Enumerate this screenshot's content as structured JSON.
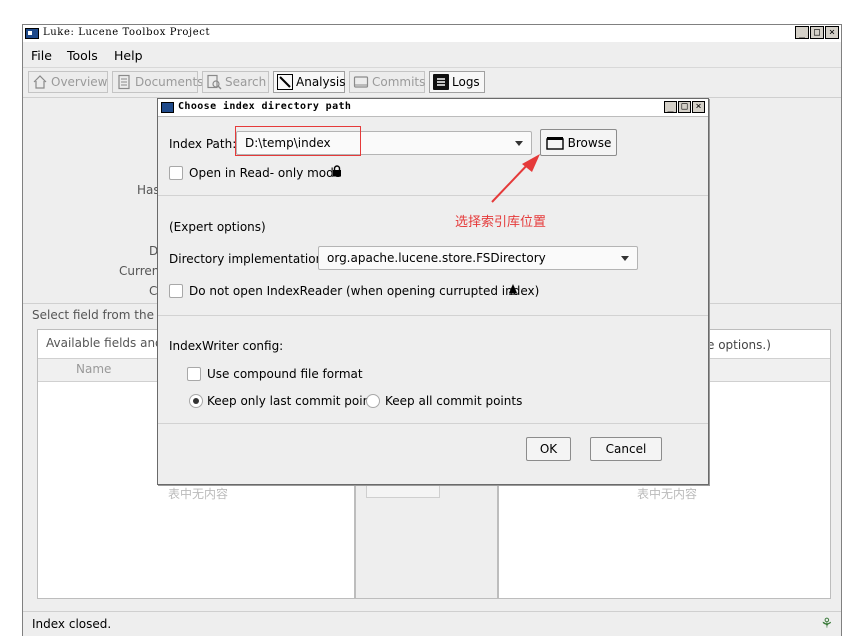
{
  "app": {
    "title": "Luke: Lucene Toolbox Project"
  },
  "window_buttons": [
    "_",
    "□",
    "×"
  ],
  "menu": [
    {
      "label": "File"
    },
    {
      "label": "Tools"
    },
    {
      "label": "Help"
    }
  ],
  "tabs": [
    {
      "label": "Overview",
      "icon": "home-icon",
      "active": false
    },
    {
      "label": "Documents",
      "icon": "document-icon",
      "active": false
    },
    {
      "label": "Search",
      "icon": "search-icon",
      "active": false
    },
    {
      "label": "Analysis",
      "icon": "wand-icon",
      "active": true
    },
    {
      "label": "Commits",
      "icon": "commits-icon",
      "active": false
    },
    {
      "label": "Logs",
      "icon": "logs-icon",
      "active": true
    }
  ],
  "background": {
    "label_has": "Has",
    "label_d": "D",
    "label_current": "Curren",
    "label_c": "C",
    "select_field": "Select field from the lis",
    "available_fields": "Available fields and t",
    "name_header": "Name",
    "more_options": "ore options.)",
    "empty_left": "表中无内容",
    "empty_right": "表中无内容"
  },
  "dialog": {
    "title": "Choose index directory path",
    "index_path_label": "Index Path:",
    "index_path_value": "D:\\temp\\index",
    "browse_label": "Browse",
    "read_only_label": "Open in Read- only mode",
    "expert_options": "(Expert options)",
    "dir_impl_label": "Directory implementation:",
    "dir_impl_value": "org.apache.lucene.store.FSDirectory",
    "no_reader_label": "Do not open IndexReader (when opening currupted index)",
    "writer_config": "IndexWriter config:",
    "compound_label": "Use compound file format",
    "keep_last_label": "Keep only last commit point",
    "keep_all_label": "Keep all commit points",
    "ok_label": "OK",
    "cancel_label": "Cancel"
  },
  "annotation": {
    "text": "选择索引库位置",
    "color": "#e53a3a"
  },
  "status": {
    "text": "Index closed."
  }
}
